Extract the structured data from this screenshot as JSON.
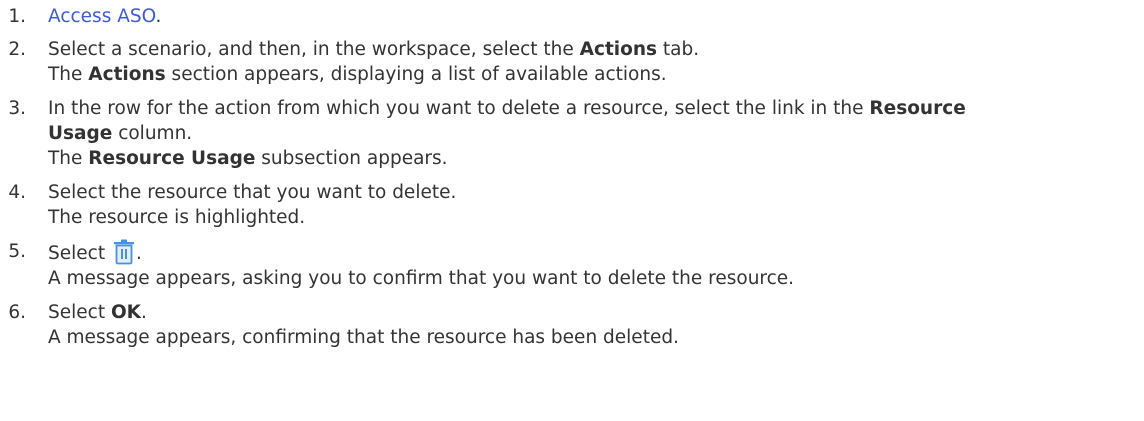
{
  "steps": [
    {
      "number": "1.",
      "link_text": "Access ASO",
      "after_link": "."
    },
    {
      "number": "2.",
      "pre": "Select a scenario, and then, in the workspace, select the ",
      "bold": "Actions",
      "post": " tab.",
      "result_bold": "Actions",
      "result_post": " section appears, displaying a list of available actions.",
      "result_pre": "The "
    },
    {
      "number": "3.",
      "pre": "In the row for the action from which you want to delete a resource, select the link in the ",
      "bold1": "Resource",
      "bold2": "Usage",
      "post": " column.",
      "result_pre": "The ",
      "result_bold": "Resource Usage",
      "result_post": " subsection appears."
    },
    {
      "number": "4.",
      "text": "Select the resource that you want to delete.",
      "result": "The resource is highlighted."
    },
    {
      "number": "5.",
      "pre": "Select ",
      "icon": "trash-icon",
      "post": ".",
      "result": "A message appears, asking you to confirm that you want to delete the resource."
    },
    {
      "number": "6.",
      "pre": "Select ",
      "bold": "OK",
      "post": ".",
      "result": "A message appears, confirming that the resource has been deleted."
    }
  ],
  "colors": {
    "text": "#333333",
    "link": "#3b5bdb",
    "icon": "#4a8fe0"
  }
}
